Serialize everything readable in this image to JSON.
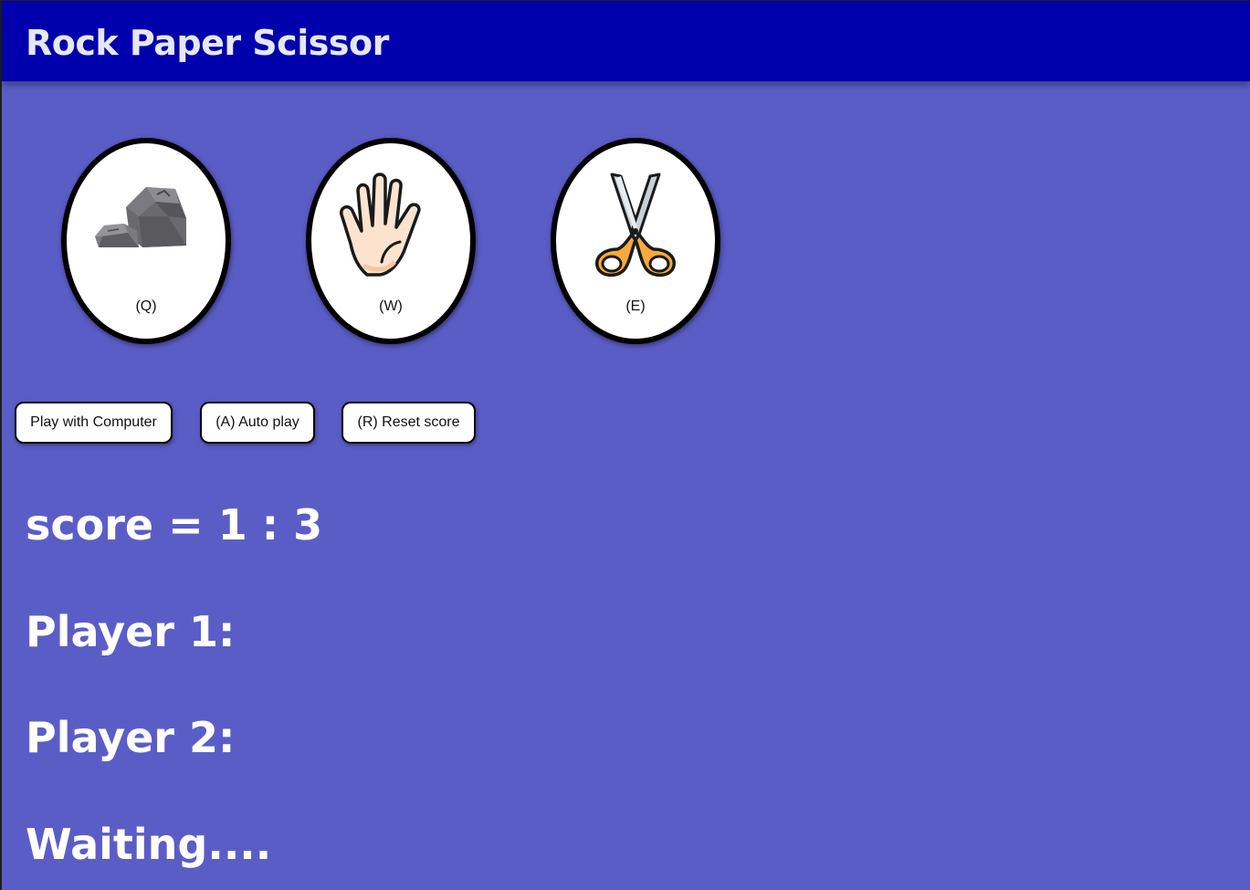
{
  "header": {
    "title": "Rock Paper Scissor"
  },
  "choices": [
    {
      "name": "rock",
      "key": "(Q)",
      "icon": "rock-icon"
    },
    {
      "name": "paper",
      "key": "(W)",
      "icon": "hand-icon"
    },
    {
      "name": "scissors",
      "key": "(E)",
      "icon": "scissors-icon"
    }
  ],
  "buttons": {
    "play_computer": "Play with Computer",
    "auto_play": "(A) Auto play",
    "reset_score": "(R) Reset score"
  },
  "score": {
    "text": "score = 1 : 3"
  },
  "players": {
    "player1_label": "Player 1:",
    "player2_label": "Player 2:"
  },
  "status": {
    "text": "Waiting...."
  },
  "colors": {
    "header_bg": "#0000ad",
    "page_bg": "#5b5dc7",
    "text": "#ffffff"
  }
}
